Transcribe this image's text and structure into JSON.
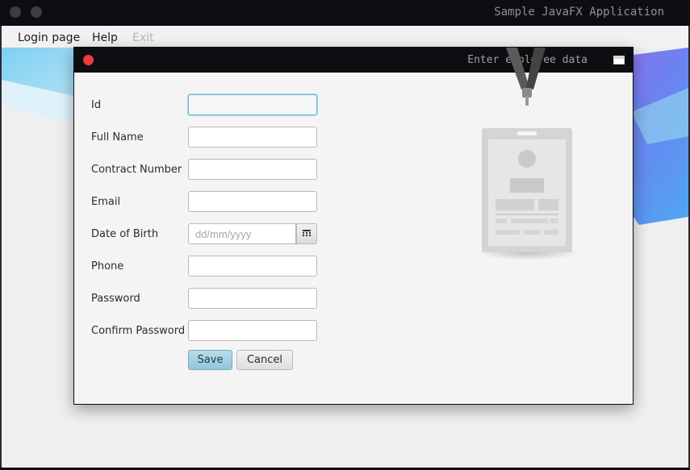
{
  "window": {
    "title": "Sample JavaFX Application"
  },
  "menu": {
    "items": [
      {
        "label": "Login page",
        "enabled": true
      },
      {
        "label": "Help",
        "enabled": true
      },
      {
        "label": "Exit",
        "enabled": false
      }
    ]
  },
  "dialog": {
    "title": "Enter employee data",
    "fields": [
      {
        "label": "Id",
        "value": "",
        "focused": true
      },
      {
        "label": "Full Name",
        "value": ""
      },
      {
        "label": "Contract Number",
        "value": ""
      },
      {
        "label": "Email",
        "value": ""
      },
      {
        "label": "Date of Birth",
        "value": "",
        "placeholder": "dd/mm/yyyy"
      },
      {
        "label": "Phone",
        "value": ""
      },
      {
        "label": "Password",
        "value": ""
      },
      {
        "label": "Confirm Password",
        "value": ""
      }
    ],
    "buttons": {
      "save": "Save",
      "cancel": "Cancel"
    }
  },
  "colors": {
    "titlebar": "#0d0e12",
    "close": "#ef3b3b",
    "save_button": "#a7d2e4",
    "focus_ring": "#6cb9d6"
  },
  "icons": [
    "close-icon",
    "maximize-icon",
    "calendar-icon",
    "id-badge-icon"
  ]
}
